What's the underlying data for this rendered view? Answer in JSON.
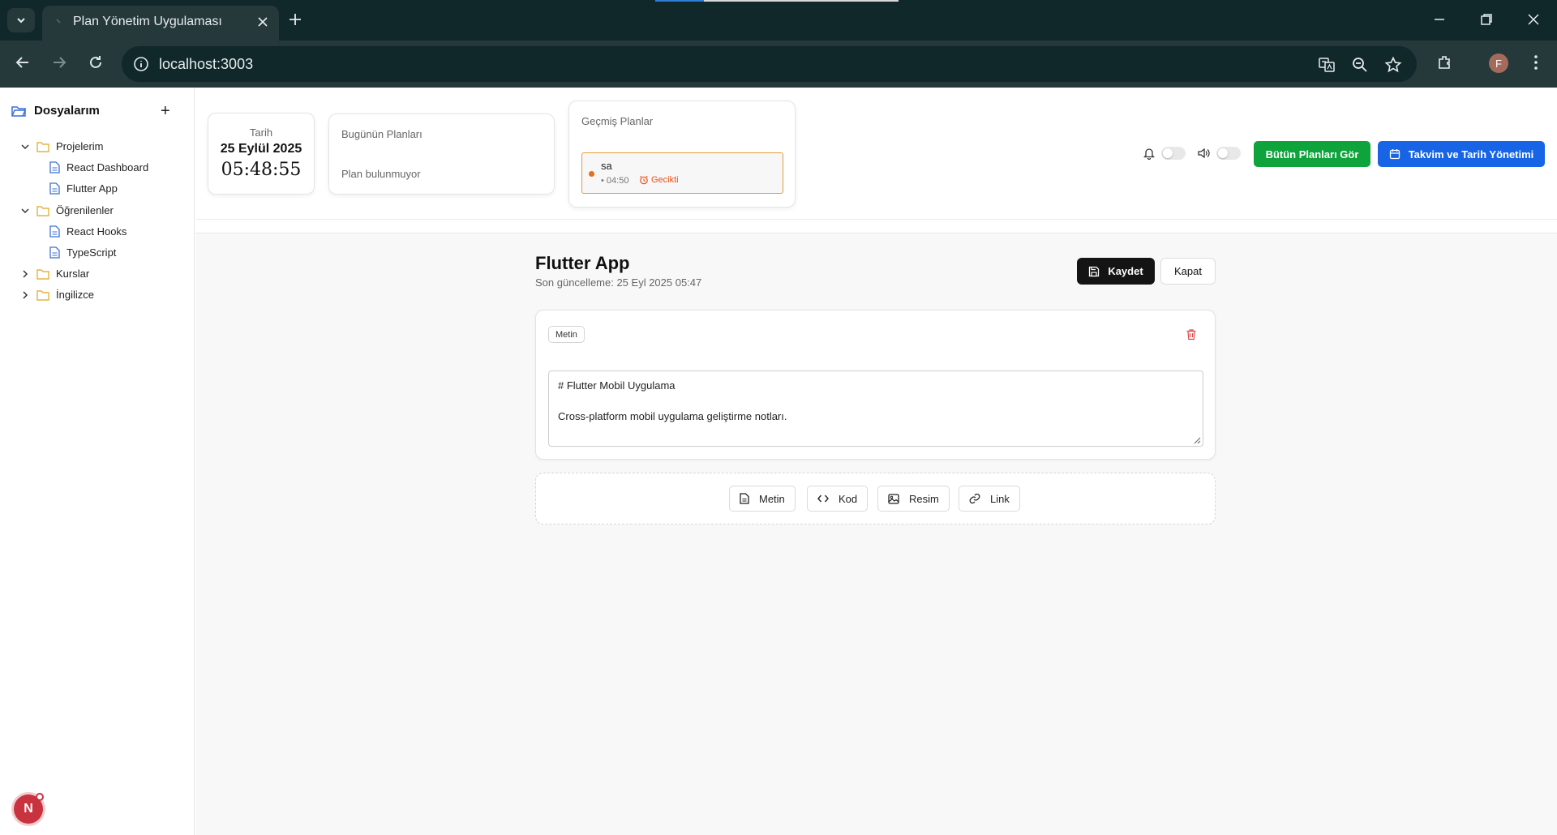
{
  "browser": {
    "tab_title": "Plan Yönetim Uygulaması",
    "url": "localhost:3003",
    "profile_initial": "F"
  },
  "sidebar": {
    "title": "Dosyalarım",
    "tree": [
      {
        "label": "Projelerim",
        "type": "folder",
        "expanded": true
      },
      {
        "label": "React Dashboard",
        "type": "file"
      },
      {
        "label": "Flutter App",
        "type": "file"
      },
      {
        "label": "Öğrenilenler",
        "type": "folder",
        "expanded": true
      },
      {
        "label": "React Hooks",
        "type": "file"
      },
      {
        "label": "TypeScript",
        "type": "file"
      },
      {
        "label": "Kurslar",
        "type": "folder",
        "expanded": false
      },
      {
        "label": "İngilizce",
        "type": "folder",
        "expanded": false
      }
    ],
    "badge": "N"
  },
  "widgets": {
    "date_label": "Tarih",
    "date_value": "25 Eylül 2025",
    "time_value": "05:48:55",
    "today_title": "Bugünün Planları",
    "today_empty": "Plan bulunmuyor",
    "past_title": "Geçmiş Planlar",
    "past_item": {
      "name": "sa",
      "time": "• 04:50",
      "status": "Gecikti"
    },
    "all_plans_label": "Bütün Planları Gör",
    "calendar_label": "Takvim ve Tarih Yönetimi"
  },
  "editor": {
    "title": "Flutter App",
    "subtitle": "Son güncelleme: 25 Eyl 2025 05:47",
    "save_label": "Kaydet",
    "close_label": "Kapat",
    "block_type": "Metin",
    "content_line1": "# Flutter Mobil Uygulama",
    "content_line2": "Cross-platform mobil uygulama geliştirme notları.",
    "add_buttons": [
      "Metin",
      "Kod",
      "Resim",
      "Link"
    ]
  },
  "colors": {
    "green": "#0fa33c",
    "blue": "#1765e6",
    "late": "#ea4f16",
    "folder": "#e3b341",
    "file": "#3b6fd8"
  }
}
